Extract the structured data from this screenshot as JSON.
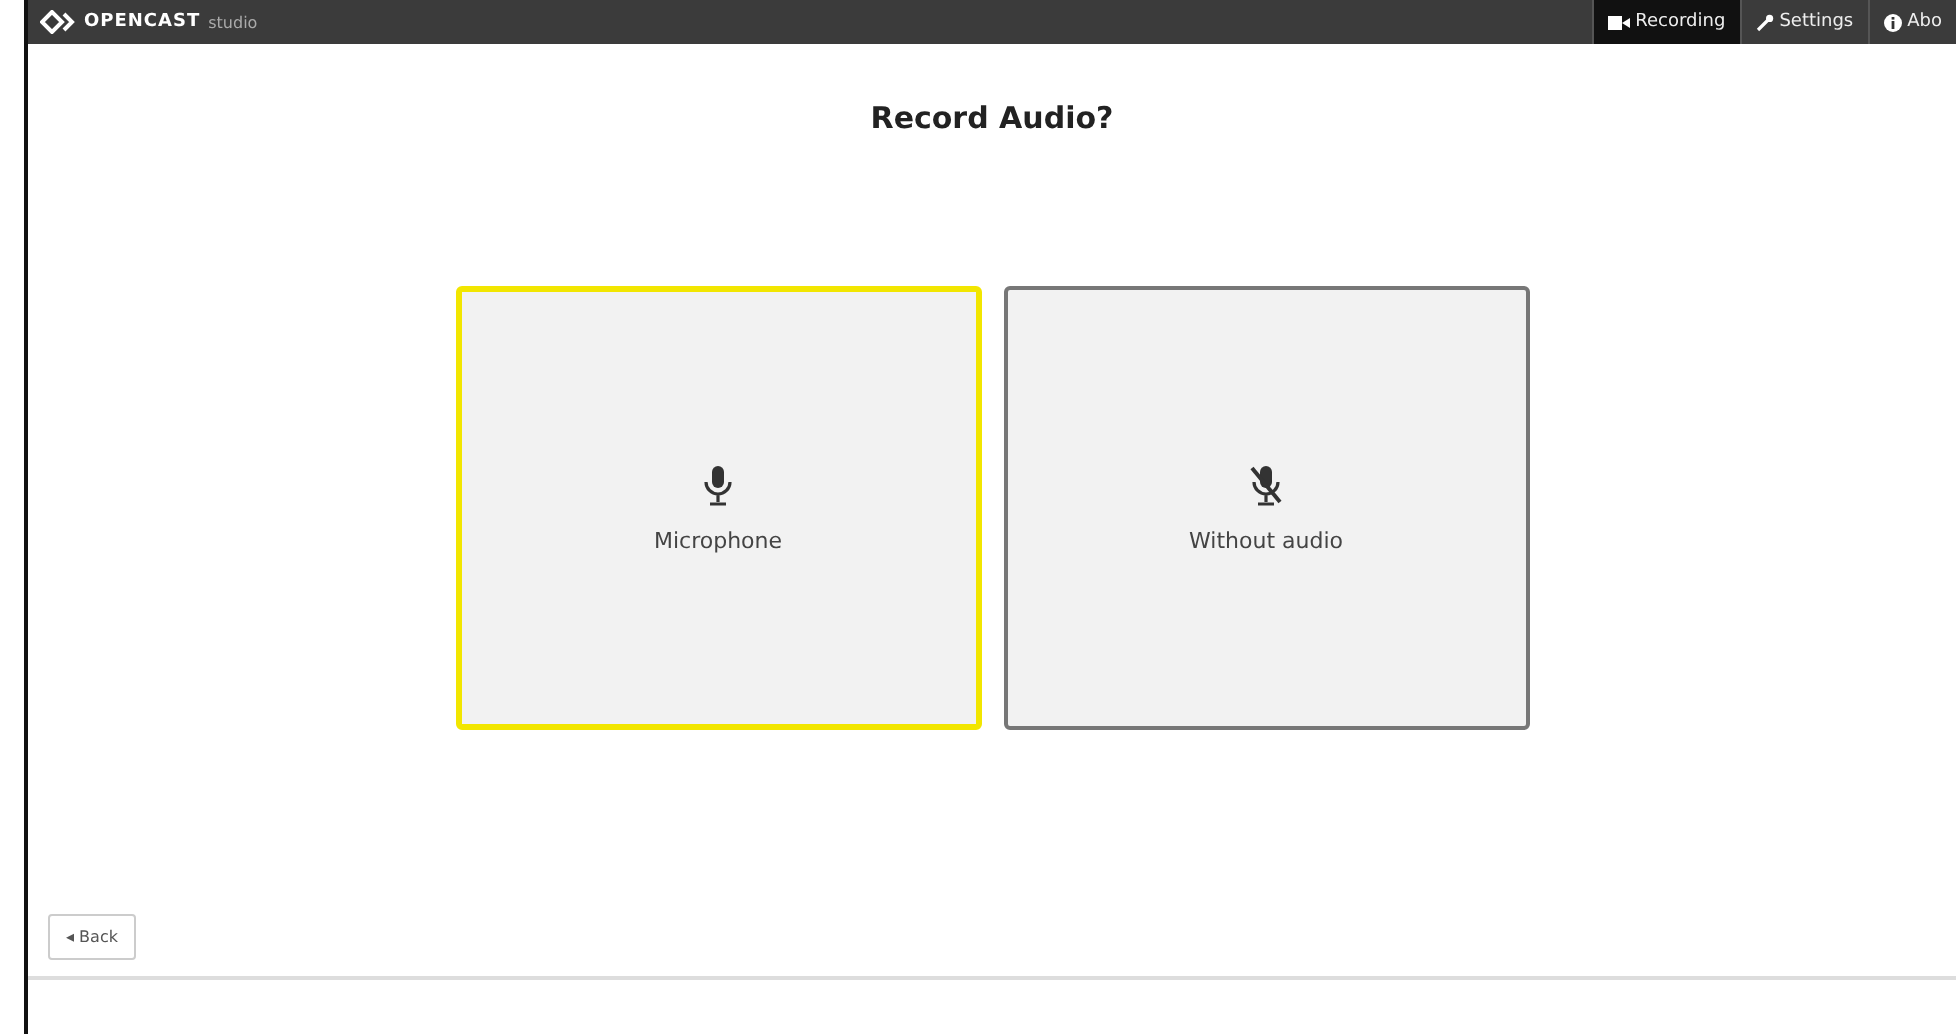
{
  "header": {
    "logo": {
      "brand": "OPENCAST",
      "product": "studio"
    },
    "nav": [
      {
        "label": "Recording",
        "kind": "recording",
        "selected": true
      },
      {
        "label": "Settings",
        "kind": "settings",
        "selected": false
      },
      {
        "label": "Abo",
        "kind": "about",
        "selected": false
      }
    ]
  },
  "title": "Record Audio?",
  "options": [
    {
      "label": "Microphone",
      "kind": "microphone",
      "selected": true
    },
    {
      "label": "Without audio",
      "kind": "none",
      "selected": false
    }
  ],
  "back_button": {
    "label": "◂ Back"
  }
}
